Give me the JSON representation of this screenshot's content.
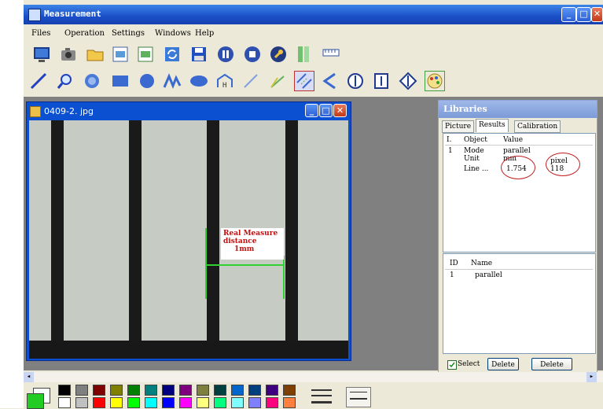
{
  "window": {
    "title": "Measurement"
  },
  "menu": {
    "items": [
      "Files",
      "Operation",
      "Settings",
      "Windows",
      "Help"
    ]
  },
  "toolbar1": {
    "tools": [
      "monitor-icon",
      "camera-icon",
      "open-folder-icon",
      "save-image-icon",
      "export-icon",
      "refresh-icon",
      "save-disk-icon",
      "pause-icon",
      "stop-icon",
      "wrench-icon",
      "ruler-bars-icon",
      "ruler-scale-icon"
    ]
  },
  "toolbar2": {
    "tools": [
      "line-icon",
      "zoom-icon",
      "arc-icon",
      "rectangle-icon",
      "circle-icon",
      "polyline-icon",
      "ellipse-icon",
      "height-icon",
      "angle-line-icon",
      "angle-icon",
      "parallel-icon",
      "triangle-angle-icon",
      "circle-mark-icon",
      "i-beam-icon",
      "diamond-mark-icon",
      "palette-icon"
    ],
    "selected": "parallel-icon"
  },
  "image_window": {
    "title": "0409-2. jpg",
    "annotation": [
      "Real Measure",
      "distance",
      "1mm"
    ]
  },
  "libraries": {
    "title": "Libraries",
    "tabs": [
      "Picture",
      "Results",
      "Calibration"
    ],
    "active_tab": "Results",
    "results_headers": [
      "I.",
      "Object",
      "Value"
    ],
    "results_rows": [
      {
        "index": "1",
        "object": "Mode",
        "value": "parallel",
        "extra": ""
      },
      {
        "index": "",
        "object": "Unit",
        "value": "mm",
        "extra": "pixel"
      },
      {
        "index": "",
        "object": "Line ...",
        "value": "1.754",
        "extra": "118"
      }
    ],
    "list_headers": [
      "ID",
      "Name"
    ],
    "list_rows": [
      {
        "id": "1",
        "name": "parallel"
      }
    ],
    "select_label": "Select",
    "delete_label": "Delete",
    "delete2_label": "Delete"
  },
  "palette": {
    "current": "#22cc22",
    "row1": [
      "#000000",
      "#7f7f7f",
      "#7f0000",
      "#7f7f00",
      "#007f00",
      "#007f7f",
      "#00007f",
      "#7f007f",
      "#7f7f3f",
      "#003f3f",
      "#0066cc",
      "#003f7f",
      "#3f007f",
      "#7f3f00"
    ],
    "row2": [
      "#ffffff",
      "#c0c0c0",
      "#ff0000",
      "#ffff00",
      "#00ff00",
      "#00ffff",
      "#0000ff",
      "#ff00ff",
      "#ffff7f",
      "#00ff7f",
      "#7fffff",
      "#7f7fff",
      "#ff007f",
      "#ff7f3f"
    ]
  }
}
